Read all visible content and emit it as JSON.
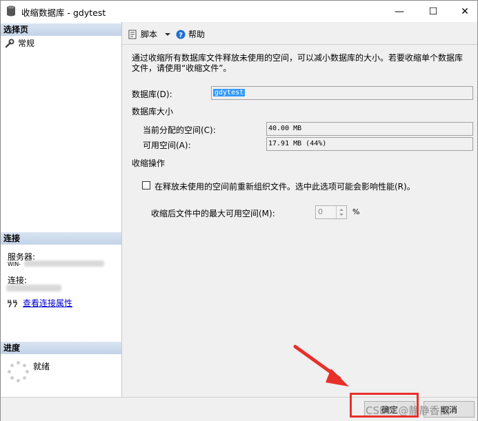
{
  "window": {
    "title": "收缩数据库 - gdytest",
    "minimize": "—",
    "maximize": "☐",
    "close": "✕"
  },
  "sidebar": {
    "select_page_header": "选择页",
    "pages": [
      {
        "label": "常规"
      }
    ],
    "connection_header": "连接",
    "server_label": "服务器:",
    "server_value": "WIN-",
    "connection_label": "连接:",
    "view_connection_props": "查看连接属性",
    "progress_header": "进度",
    "progress_status": "就绪"
  },
  "toolbar": {
    "script_label": "脚本",
    "help_label": "帮助"
  },
  "main": {
    "description": "通过收缩所有数据库文件释放未使用的空间，可以减小数据库的大小。若要收缩单个数据库文件，请使用“收缩文件”。",
    "database_label": "数据库(D):",
    "database_value": "gdytest",
    "db_size_section": "数据库大小",
    "allocated_label": "当前分配的空间(C):",
    "allocated_value": "40.00 MB",
    "available_label": "可用空间(A):",
    "available_value": "17.91 MB (44%)",
    "shrink_section": "收缩操作",
    "reorganize_label": "在释放未使用的空间前重新组织文件。选中此选项可能会影响性能(R)。",
    "reorganize_checked": false,
    "max_free_label": "收缩后文件中的最大可用空间(M):",
    "max_free_value": "0",
    "percent_sign": "%"
  },
  "footer": {
    "ok_label": "确定",
    "cancel_label": "取消",
    "watermark": "CSDN @静静香田"
  },
  "colors": {
    "highlight": "#3399ff",
    "annotation_red": "#e8302a",
    "link": "#0000cc"
  }
}
